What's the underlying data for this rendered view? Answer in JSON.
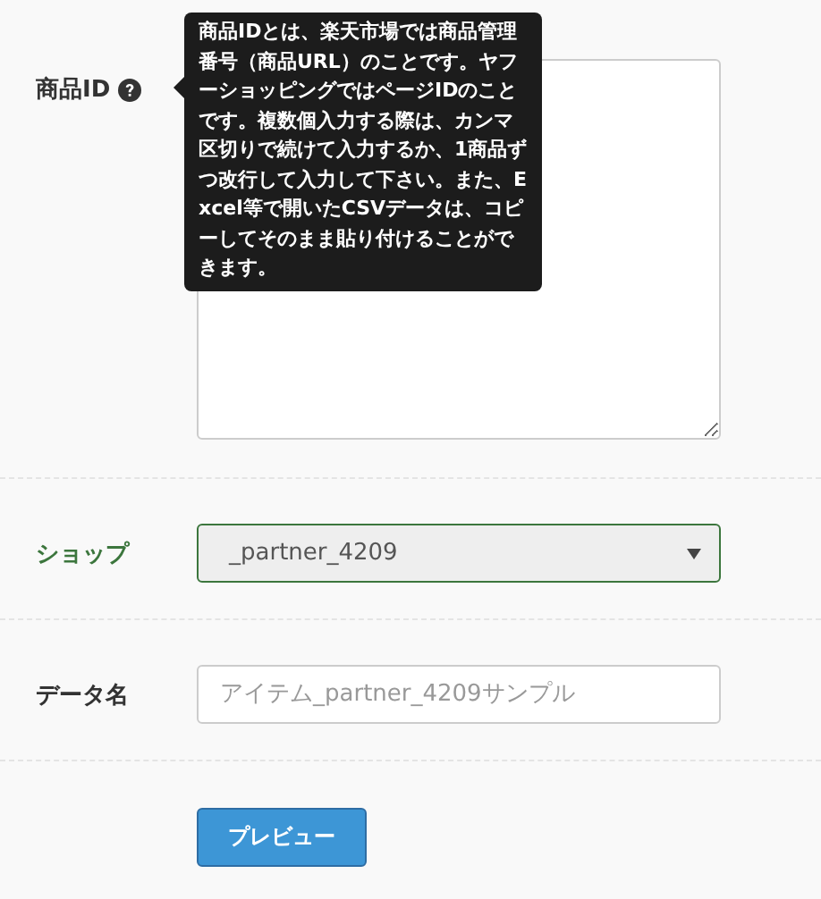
{
  "fields": [
    {
      "kind": "textarea",
      "label": "商品ID",
      "help": true
    },
    {
      "kind": "select",
      "label": "ショップ",
      "valid": true,
      "value": "_partner_4209"
    },
    {
      "kind": "input",
      "label": "データ名",
      "placeholder": "アイテム_partner_4209サンプル"
    }
  ],
  "tooltip": {
    "text": "商品IDとは、楽天市場では商品管理番号（商品URL）のことです。ヤフーショッピングではページIDのことです。複数個入力する際は、カンマ区切りで続けて入力するか、1商品ずつ改行して入力して下さい。また、Excel等で開いたCSVデータは、コピーしてそのまま貼り付けることができます。"
  },
  "button": {
    "label": "プレビュー"
  }
}
